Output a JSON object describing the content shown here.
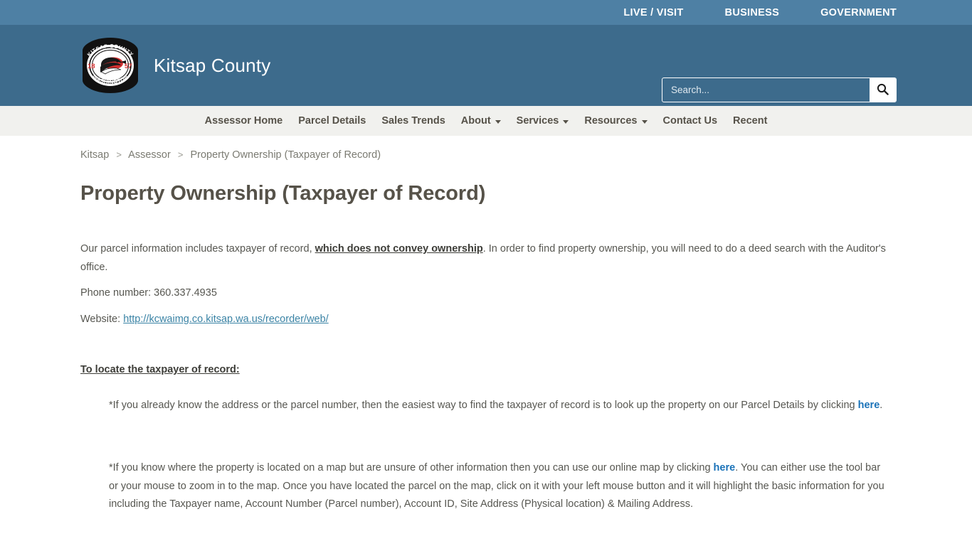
{
  "topbar": {
    "links": [
      {
        "label": "LIVE / VISIT",
        "name": "topbar-link-live-visit"
      },
      {
        "label": "BUSINESS",
        "name": "topbar-link-business"
      },
      {
        "label": "GOVERNMENT",
        "name": "topbar-link-government"
      }
    ],
    "background": "#4e80a4"
  },
  "masthead": {
    "background": "#3d6b8c",
    "site_title": "Kitsap County",
    "seal": {
      "top_text": "KITSAP COUNTY",
      "bottom_text": "WASHINGTON",
      "left_year": "18",
      "right_year": "57",
      "accent": "#d32f2f"
    },
    "search": {
      "placeholder": "Search...",
      "value": "",
      "button_icon": "search-icon"
    }
  },
  "sectionnav": {
    "background": "#f1f1ee",
    "text_color": "#565249",
    "items": [
      {
        "label": "Assessor Home",
        "name": "nav-assessor-home",
        "caret": false
      },
      {
        "label": "Parcel Details",
        "name": "nav-parcel-details",
        "caret": false
      },
      {
        "label": "Sales Trends",
        "name": "nav-sales-trends",
        "caret": false
      },
      {
        "label": "About",
        "name": "nav-about",
        "caret": true
      },
      {
        "label": "Services",
        "name": "nav-services",
        "caret": true
      },
      {
        "label": "Resources",
        "name": "nav-resources",
        "caret": true
      },
      {
        "label": "Contact Us",
        "name": "nav-contact-us",
        "caret": false
      },
      {
        "label": "Recent",
        "name": "nav-recent",
        "caret": false
      }
    ]
  },
  "breadcrumb": {
    "items": [
      "Kitsap",
      "Assessor",
      "Property Ownership (Taxpayer of Record)"
    ],
    "separator": ">"
  },
  "page": {
    "title": "Property Ownership (Taxpayer of Record)"
  },
  "body": {
    "intro_part1": "Our parcel information includes taxpayer of record, ",
    "intro_emph": "which does not convey ownership",
    "intro_part2": ".  In order to find property ownership, you will need to do a deed search with the Auditor's office.",
    "phone_line": "Phone number: 360.337.4935",
    "website_label": "Website: ",
    "website_url": "http://kcwaimg.co.kitsap.wa.us/recorder/web/",
    "locate_heading": "To locate the taxpayer of record:",
    "bullet1_part1": "*If you already know the address or the parcel number, then the easiest way to find the taxpayer of record is to look up the property on our Parcel Details by clicking ",
    "bullet1_link": "here",
    "bullet1_part2": ".",
    "bullet2_part1": "*If you know where the property is located on a map but are unsure of other information then you can use our online map by clicking ",
    "bullet2_link": "here",
    "bullet2_part2": ".   You can either use the tool bar or your mouse to zoom in to the map.  Once you have located the parcel on the map, click on it with your left mouse button and it will highlight the basic information for you including the Taxpayer name, Account Number (Parcel number), Account ID, Site Address (Physical location) & Mailing Address."
  }
}
